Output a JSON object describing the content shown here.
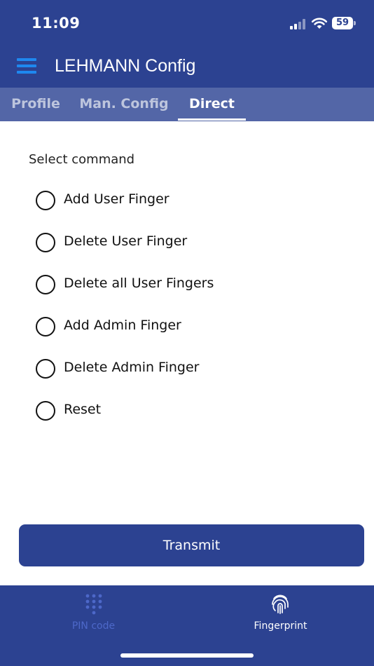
{
  "status_bar": {
    "time": "11:09",
    "battery": "59"
  },
  "app_bar": {
    "title": "LEHMANN Config"
  },
  "tabs": [
    {
      "label": "Profile",
      "active": false
    },
    {
      "label": "Man. Config",
      "active": false
    },
    {
      "label": "Direct",
      "active": true
    }
  ],
  "command_section": {
    "label": "Select command",
    "options": [
      {
        "label": "Add User Finger"
      },
      {
        "label": "Delete User Finger"
      },
      {
        "label": "Delete all User Fingers"
      },
      {
        "label": "Add Admin Finger"
      },
      {
        "label": "Delete Admin Finger"
      },
      {
        "label": "Reset"
      }
    ]
  },
  "transmit_button": {
    "label": "Transmit"
  },
  "bottom_nav": {
    "items": [
      {
        "label": "PIN code",
        "icon": "keypad-icon",
        "active": false
      },
      {
        "label": "Fingerprint",
        "icon": "fingerprint-icon",
        "active": true
      }
    ]
  },
  "colors": {
    "primary": "#2c4291",
    "tab_bar": "#5366a7",
    "menu_icon": "#1e88f0",
    "nav_inactive": "#4d68c9"
  }
}
